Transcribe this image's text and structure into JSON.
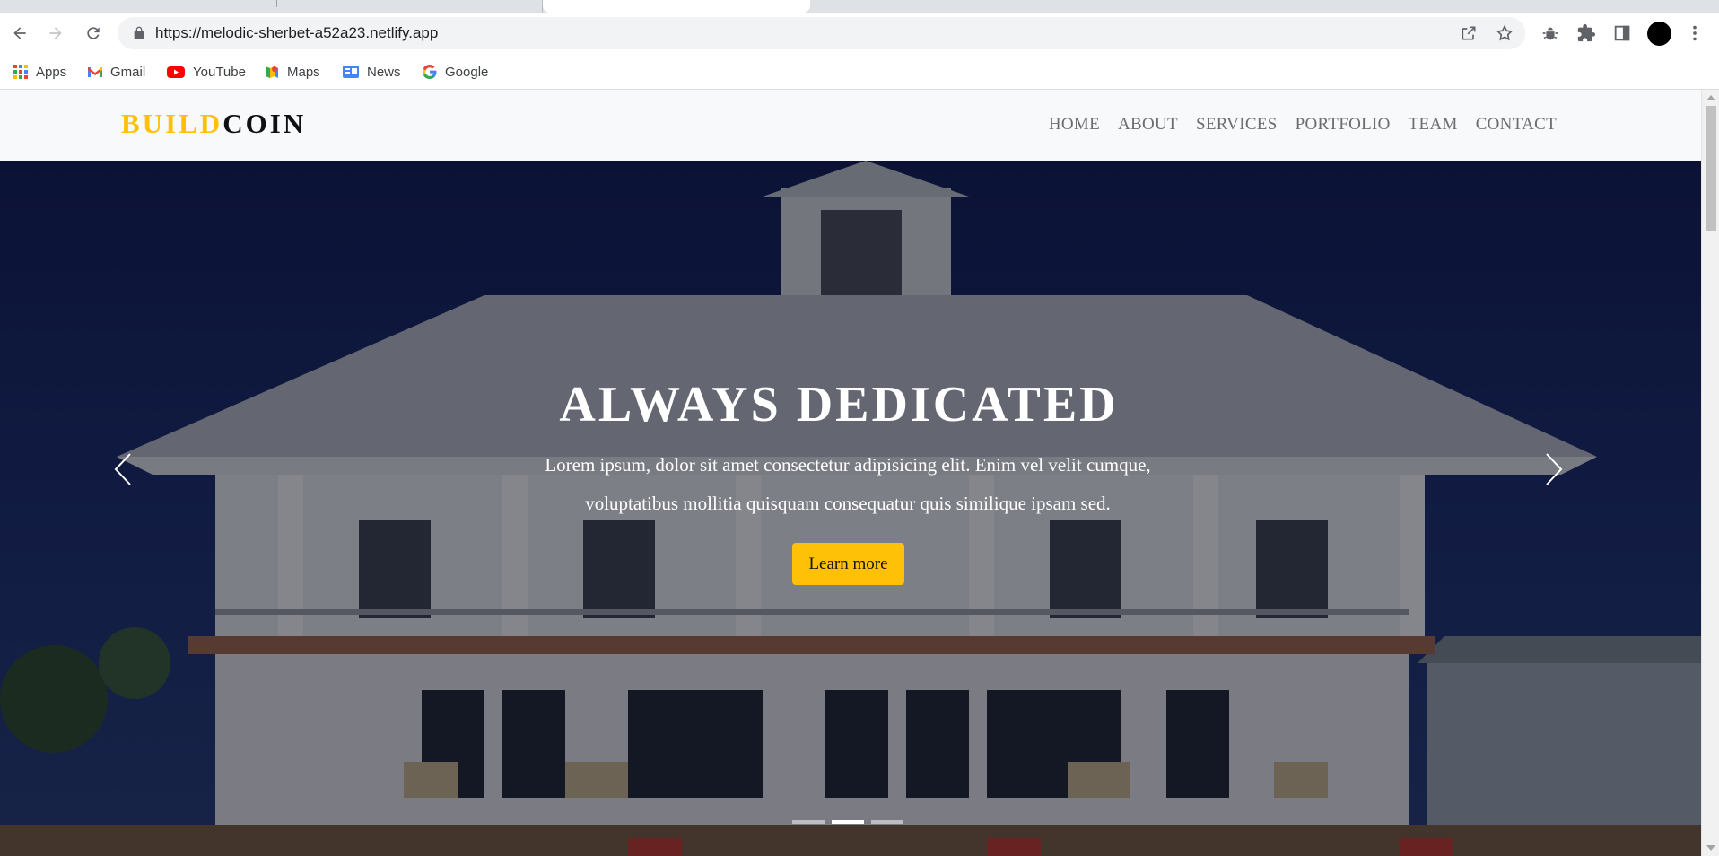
{
  "browser": {
    "url": "https://melodic-sherbet-a52a23.netlify.app",
    "bookmarks": [
      {
        "label": "Apps",
        "icon": "apps-grid-icon"
      },
      {
        "label": "Gmail",
        "icon": "gmail-icon"
      },
      {
        "label": "YouTube",
        "icon": "youtube-icon"
      },
      {
        "label": "Maps",
        "icon": "maps-icon"
      },
      {
        "label": "News",
        "icon": "news-icon"
      },
      {
        "label": "Google",
        "icon": "google-icon"
      }
    ]
  },
  "site": {
    "brand_part1": "BUILD",
    "brand_part2": "COIN",
    "brand_colors": {
      "accent": "#ffc107",
      "dark": "#111111"
    },
    "menu": [
      "HOME",
      "ABOUT",
      "SERVICES",
      "PORTFOLIO",
      "TEAM",
      "CONTACT"
    ]
  },
  "hero": {
    "title": "ALWAYS DEDICATED",
    "text": "Lorem ipsum, dolor sit amet consectetur adipisicing elit. Enim vel velit cumque, voluptatibus mollitia quisquam consequatur quis similique ipsam sed.",
    "button": "Learn more",
    "button_color": "#ffc107",
    "slides": 3,
    "active_slide": 2
  }
}
